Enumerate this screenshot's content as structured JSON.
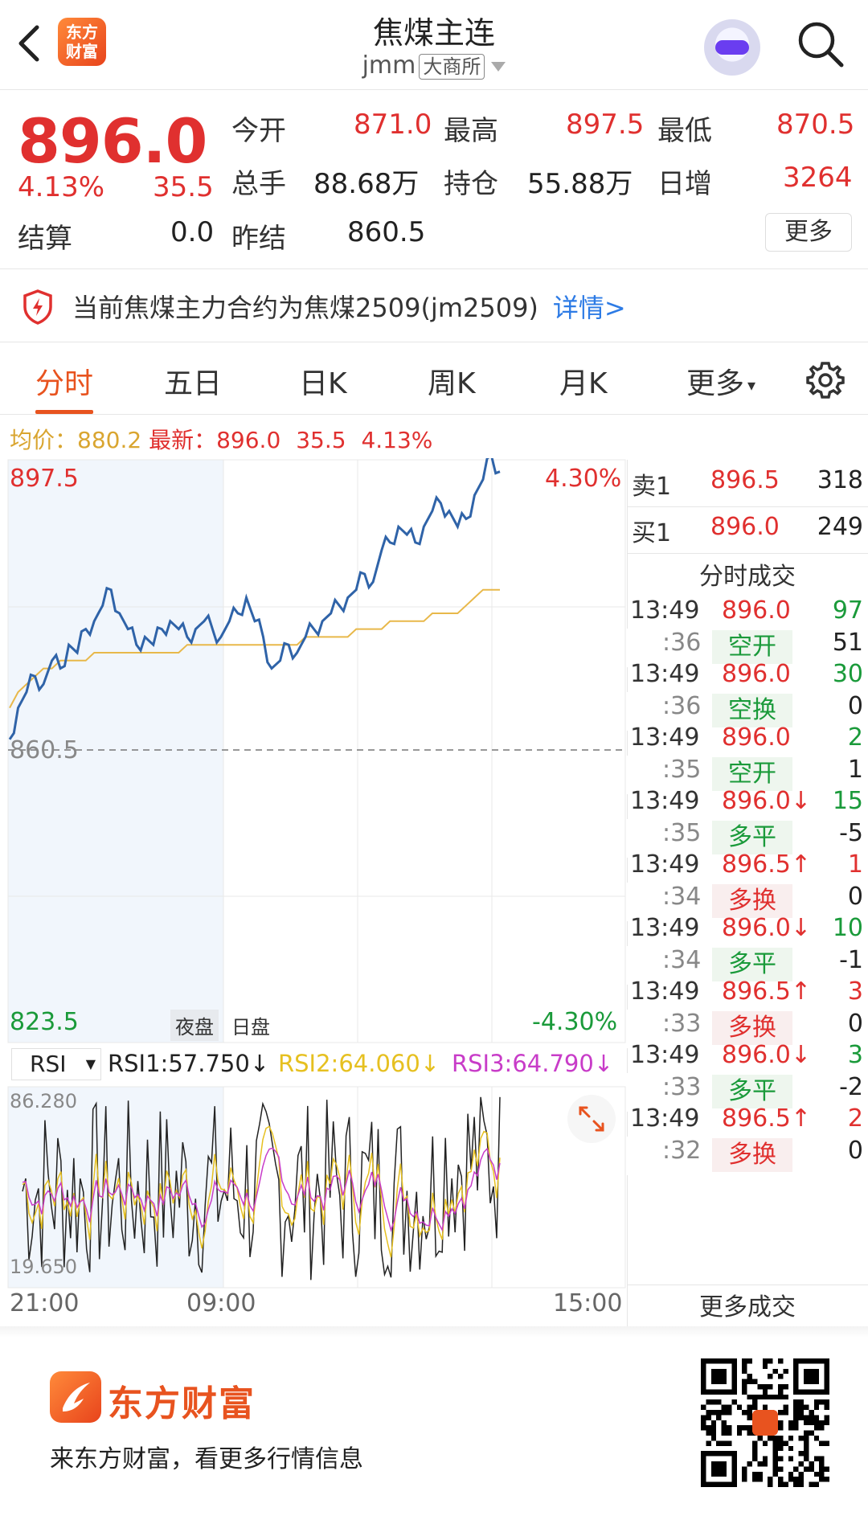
{
  "header": {
    "logo_text_1": "东方",
    "logo_text_2": "财富",
    "title": "焦煤主连",
    "code": "jmm",
    "exchange": "大商所"
  },
  "quote": {
    "price": "896.0",
    "change_pct": "4.13%",
    "change": "35.5",
    "settle_label": "结算",
    "settle": "0.0",
    "open_label": "今开",
    "open": "871.0",
    "high_label": "最高",
    "high": "897.5",
    "low_label": "最低",
    "low": "870.5",
    "volume_label": "总手",
    "volume": "88.68万",
    "oi_label": "持仓",
    "oi": "55.88万",
    "daily_inc_label": "日增",
    "daily_inc": "3264",
    "prev_settle_label": "昨结",
    "prev_settle": "860.5",
    "more_label": "更多"
  },
  "notice": {
    "text": "当前焦煤主力合约为焦煤2509(jm2509)",
    "link": "详情>"
  },
  "tabs": [
    "分时",
    "五日",
    "日K",
    "周K",
    "月K",
    "更多"
  ],
  "avg": {
    "avg_label": "均价：",
    "avg_value": "880.2",
    "latest_label": "最新：",
    "latest_value": "896.0",
    "latest_change": "35.5",
    "latest_pct": "4.13%"
  },
  "chart_labels": {
    "y_top": "897.5",
    "y_mid": "860.5",
    "y_bottom": "823.5",
    "pct_top": "4.30%",
    "pct_bottom": "-4.30%",
    "night": "夜盘",
    "day": "日盘",
    "x_start": "21:00",
    "x_mid": "09:00",
    "x_end": "15:00"
  },
  "rsi": {
    "select": "RSI",
    "rsi1": "RSI1:57.750",
    "rsi2": "RSI2:64.060",
    "rsi3": "RSI3:64.790",
    "down_arrow": "↓",
    "top": "86.280",
    "bottom": "19.650"
  },
  "book": {
    "sell_label": "卖1",
    "sell_price": "896.5",
    "sell_vol": "318",
    "buy_label": "买1",
    "buy_price": "896.0",
    "buy_vol": "249"
  },
  "ticks_title": "分时成交",
  "ticks": [
    {
      "time": "13:49",
      "price": "896.0",
      "vol": "97",
      "sub": ":36",
      "type": "空开",
      "ntype": "51",
      "vcolor": "green",
      "tcolor": "green"
    },
    {
      "time": "13:49",
      "price": "896.0",
      "vol": "30",
      "sub": ":36",
      "type": "空换",
      "ntype": "0",
      "vcolor": "green",
      "tcolor": "green"
    },
    {
      "time": "13:49",
      "price": "896.0",
      "vol": "2",
      "sub": ":35",
      "type": "空开",
      "ntype": "1",
      "vcolor": "green",
      "tcolor": "green"
    },
    {
      "time": "13:49",
      "price": "896.0↓",
      "vol": "15",
      "sub": ":35",
      "type": "多平",
      "ntype": "-5",
      "vcolor": "green",
      "tcolor": "green"
    },
    {
      "time": "13:49",
      "price": "896.5↑",
      "vol": "1",
      "sub": ":34",
      "type": "多换",
      "ntype": "0",
      "vcolor": "red",
      "tcolor": "red"
    },
    {
      "time": "13:49",
      "price": "896.0↓",
      "vol": "10",
      "sub": ":34",
      "type": "多平",
      "ntype": "-1",
      "vcolor": "green",
      "tcolor": "green"
    },
    {
      "time": "13:49",
      "price": "896.5↑",
      "vol": "3",
      "sub": ":33",
      "type": "多换",
      "ntype": "0",
      "vcolor": "red",
      "tcolor": "red"
    },
    {
      "time": "13:49",
      "price": "896.0↓",
      "vol": "3",
      "sub": ":33",
      "type": "多平",
      "ntype": "-2",
      "vcolor": "green",
      "tcolor": "green"
    },
    {
      "time": "13:49",
      "price": "896.5↑",
      "vol": "2",
      "sub": ":32",
      "type": "多换",
      "ntype": "0",
      "vcolor": "red",
      "tcolor": "red"
    }
  ],
  "more_trades": "更多成交",
  "footer": {
    "brand": "东方财富",
    "slogan": "来东方财富，看更多行情信息"
  },
  "chart_data": {
    "type": "line",
    "y_range": [
      823.5,
      897.5
    ],
    "price_series": [
      862,
      866,
      868,
      870,
      869,
      872,
      871,
      874,
      873,
      876,
      877,
      879,
      881,
      878,
      876,
      874,
      875,
      874,
      876,
      877,
      876,
      875,
      876,
      877,
      876,
      875,
      877,
      878,
      880,
      877,
      875,
      871,
      872,
      874,
      873,
      875,
      876,
      877,
      878,
      879,
      880,
      881,
      883,
      882,
      886,
      887,
      889,
      888,
      887,
      889,
      891,
      892,
      891,
      889,
      890,
      893,
      895,
      898,
      896
    ],
    "avg_series": [
      866,
      868,
      869,
      870,
      871,
      871,
      872,
      872,
      872,
      872,
      873,
      873,
      873,
      873,
      873,
      873,
      873,
      873,
      873,
      873,
      873,
      874,
      874,
      874,
      874,
      874,
      874,
      874,
      874,
      874,
      874,
      874,
      874,
      874,
      874,
      875,
      875,
      875,
      875,
      875,
      875,
      876,
      876,
      876,
      876,
      877,
      877,
      877,
      877,
      877,
      878,
      878,
      878,
      878,
      879,
      880,
      881,
      881,
      881
    ]
  },
  "colors": {
    "red": "#e0302f",
    "green": "#1a9a3a",
    "accent": "#e8531f",
    "price_line": "#2f63a8",
    "avg_line": "#e8b84a",
    "rsi1": "#222222",
    "rsi2": "#e6c020",
    "rsi3": "#c83cc8"
  }
}
